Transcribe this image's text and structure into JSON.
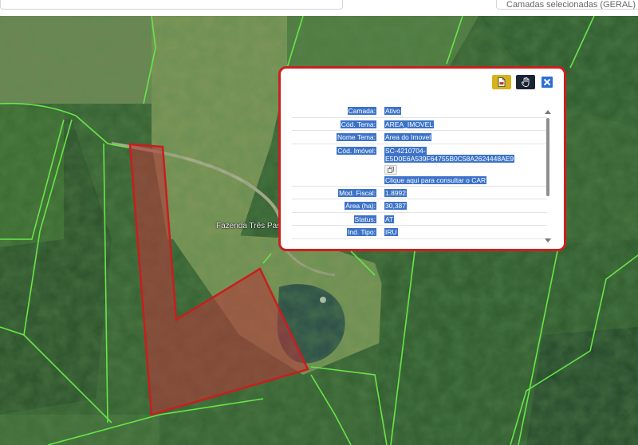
{
  "colors": {
    "parcel_outline": "#c81e1e",
    "parcel_fill": "#b13a3a",
    "boundary_lines": "#67e648",
    "popup_border": "#cc1f1f",
    "selection": "#3c73c9"
  },
  "top": {
    "layers_select_text": "Camadas selecionadas (GERAL)"
  },
  "map": {
    "label": "Fazenda Três Pass"
  },
  "popup": {
    "toolbar": {
      "pdf_icon": "pdf-file-icon",
      "hand_icon": "hand-pointer-icon",
      "close_icon": "close-icon",
      "close_label": "×"
    },
    "rows": [
      {
        "key": "Camada:",
        "value": "Ativo"
      },
      {
        "key": "Cód. Tema:",
        "value": "AREA_IMOVEL"
      },
      {
        "key": "Nome Tema:",
        "value": "Area do Imovel"
      },
      {
        "key": "Cód. Imóvel:",
        "value_line1": "SC-4210704-",
        "value_line2": "E5D0E6A539F64755B0C58A2624448AE9",
        "copy_icon": "copy-icon",
        "link": "Clique aqui para consultar o CAR"
      },
      {
        "key": "Mod. Fiscal:",
        "value": "1.8992"
      },
      {
        "key": "Área (ha):",
        "value": "30,387"
      },
      {
        "key": "Status:",
        "value": "AT"
      },
      {
        "key": "Ind. Tipo:",
        "value": "IRU"
      }
    ]
  }
}
